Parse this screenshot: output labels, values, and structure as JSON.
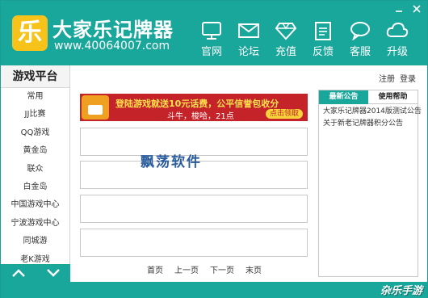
{
  "app": {
    "logo_glyph": "乐",
    "title": "大家乐记牌器",
    "url": "www.40064007.com"
  },
  "titlebar": {
    "minimize_icon": "minimize-icon",
    "close_icon": "close-icon"
  },
  "nav": [
    {
      "label": "官网",
      "icon": "monitor-icon"
    },
    {
      "label": "论坛",
      "icon": "envelope-icon"
    },
    {
      "label": "充值",
      "icon": "diamond-icon"
    },
    {
      "label": "反馈",
      "icon": "clipboard-icon"
    },
    {
      "label": "客服",
      "icon": "chat-bubble-icon"
    },
    {
      "label": "升级",
      "icon": "cloud-icon"
    }
  ],
  "sidebar": {
    "title": "游戏平台",
    "items": [
      "常用",
      "JJ比赛",
      "QQ游戏",
      "黄金岛",
      "联众",
      "白金岛",
      "中国游戏中心",
      "宁波游戏中心",
      "同城游",
      "老K游戏"
    ]
  },
  "top_links": {
    "register": "注册",
    "login": "登录"
  },
  "banner": {
    "headline": "登陆游戏就送10元话费，公平信誉包收分",
    "subline": "斗牛，梭哈，21点",
    "cta": "点击领取"
  },
  "watermark": "飘荡软件",
  "pager": {
    "first": "首页",
    "prev": "上一页",
    "next": "下一页",
    "last": "末页"
  },
  "right_panel": {
    "tabs": [
      {
        "label": "最新公告",
        "active": true
      },
      {
        "label": "使用帮助",
        "active": false
      }
    ],
    "news": [
      "大家乐记牌器2014版测试公告",
      "关于新老记牌器积分公告"
    ]
  },
  "footer": {
    "brand": "杂乐手游"
  },
  "colors": {
    "accent": "#19a79b",
    "logo_bg": "#f7c31b",
    "banner_bg": "#c5232a"
  }
}
